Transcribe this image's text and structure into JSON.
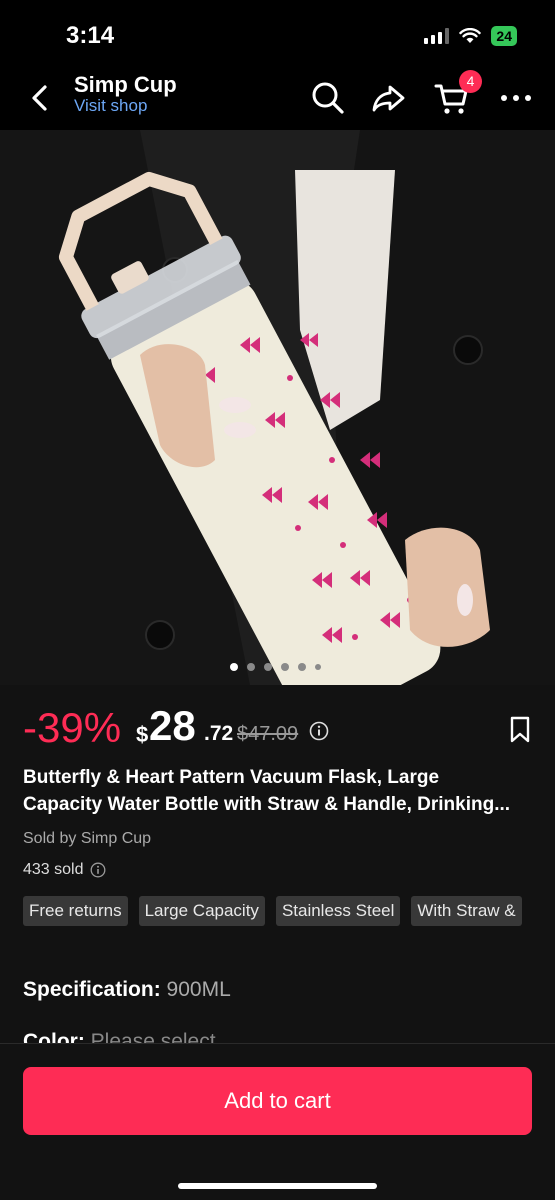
{
  "status_bar": {
    "time": "3:14",
    "battery": "24"
  },
  "header": {
    "shop_name": "Simp Cup",
    "visit_shop_label": "Visit shop",
    "cart_count": "4"
  },
  "gallery": {
    "image_count": 6,
    "active_index": 0
  },
  "price": {
    "discount": "-39%",
    "currency": "$",
    "integer": "28",
    "fraction": ".72",
    "original": "$47.09"
  },
  "title_lines": [
    "Butterfly & Heart Pattern Vacuum Flask, Large",
    "Capacity Water Bottle with Straw & Handle, Drinking..."
  ],
  "sold_by": "Sold by Simp Cup",
  "sold_count": "433 sold",
  "tags": [
    "Free returns",
    "Large Capacity",
    "Stainless Steel",
    "With Straw &"
  ],
  "specification": {
    "label": "Specification:",
    "value": "900ML"
  },
  "color": {
    "label": "Color:",
    "value": "Please select"
  },
  "add_to_cart_label": "Add to cart",
  "colors": {
    "accent": "#fe2c55",
    "link": "#6da7f5",
    "background": "#121212"
  },
  "icons": [
    "back-icon",
    "search-icon",
    "share-icon",
    "cart-icon",
    "more-icon",
    "info-icon",
    "bookmark-icon"
  ]
}
